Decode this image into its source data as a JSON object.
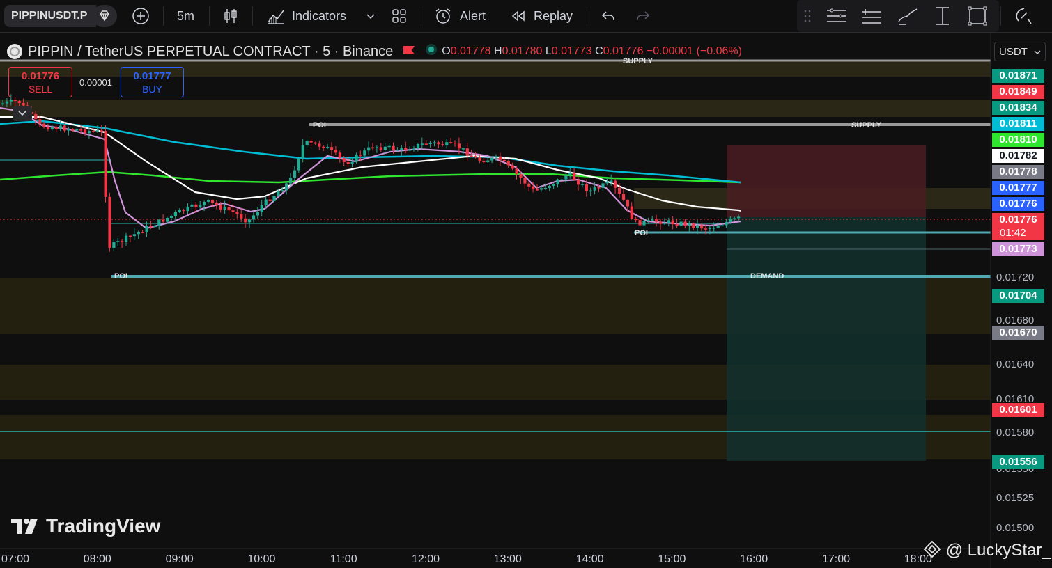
{
  "toolbar": {
    "symbol": "PIPPINUSDT.P",
    "interval": "5m",
    "indicators_label": "Indicators",
    "alert_label": "Alert",
    "replay_label": "Replay"
  },
  "legend": {
    "title": "PIPPIN / TetherUS PERPETUAL CONTRACT · 5 · Binance",
    "o_label": "O",
    "o": "0.01778",
    "h_label": "H",
    "h": "0.01780",
    "l_label": "L",
    "l": "0.01773",
    "c_label": "C",
    "c": "0.01776",
    "change": "−0.00001 (−0.06%)"
  },
  "trade": {
    "sell_price": "0.01776",
    "sell_label": "SELL",
    "spread": "0.00001",
    "buy_price": "0.01777",
    "buy_label": "BUY"
  },
  "axis": {
    "currency": "USDT",
    "countdown": "01:42"
  },
  "price_labels": [
    {
      "value": "0.01871",
      "color": "#089981"
    },
    {
      "value": "0.01849",
      "color": "#f23645"
    },
    {
      "value": "0.01834",
      "color": "#089981"
    },
    {
      "value": "0.01811",
      "color": "#00bcd4"
    },
    {
      "value": "0.01810",
      "color": "#2ee62e"
    },
    {
      "value": "0.01782",
      "color": "#ffffff"
    },
    {
      "value": "0.01778",
      "color": "#787b86"
    },
    {
      "value": "0.01777",
      "color": "#2962ff"
    },
    {
      "value": "0.01776",
      "color": "#2962ff"
    },
    {
      "value": "0.01776",
      "color": "#f23645"
    },
    {
      "value": "0.01773",
      "color": "#ce93d8"
    },
    {
      "value": "0.01704",
      "color": "#089981"
    },
    {
      "value": "0.01670",
      "color": "#787b86"
    },
    {
      "value": "0.01601",
      "color": "#f23645"
    },
    {
      "value": "0.01556",
      "color": "#089981"
    }
  ],
  "zone_labels": {
    "supply": "SUPPLY",
    "demand": "DEMAND",
    "poi": "POI"
  },
  "watermark": "TradingView",
  "credit": "@ LuckyStar_",
  "chart_data": {
    "type": "candlestick",
    "ylim": [
      0.015,
      0.0189
    ],
    "y_ticks": [
      "0.01720",
      "0.01680",
      "0.01640",
      "0.01610",
      "0.01580",
      "0.01550",
      "0.01525",
      "0.01500"
    ],
    "x_ticks": [
      "07:00",
      "08:00",
      "09:00",
      "10:00",
      "11:00",
      "12:00",
      "13:00",
      "14:00",
      "15:00",
      "16:00",
      "17:00",
      "18:00"
    ],
    "series": [
      {
        "color": "#ffffff",
        "values": [
          1.0,
          0.0,
          1.0,
          2.0,
          3.0,
          4.0,
          5.5,
          6.9,
          7.9,
          8.0,
          8.0,
          8.0,
          7.8,
          7.0,
          6.0,
          5.2
        ]
      },
      {
        "color": "#ce93d8",
        "values": [
          1.1,
          0.0,
          1.2,
          2.3,
          3.5,
          4.4,
          6.1,
          6.9,
          7.9,
          8.05,
          8.0,
          7.9,
          7.1,
          6.4,
          5.5,
          4.9
        ]
      },
      {
        "color": "#00bcd4"
      },
      {
        "color": "#2ee62e"
      }
    ],
    "last_price": 0.01776,
    "position": {
      "entry": 0.01776,
      "stop": 0.01811,
      "target": 0.01556
    }
  }
}
